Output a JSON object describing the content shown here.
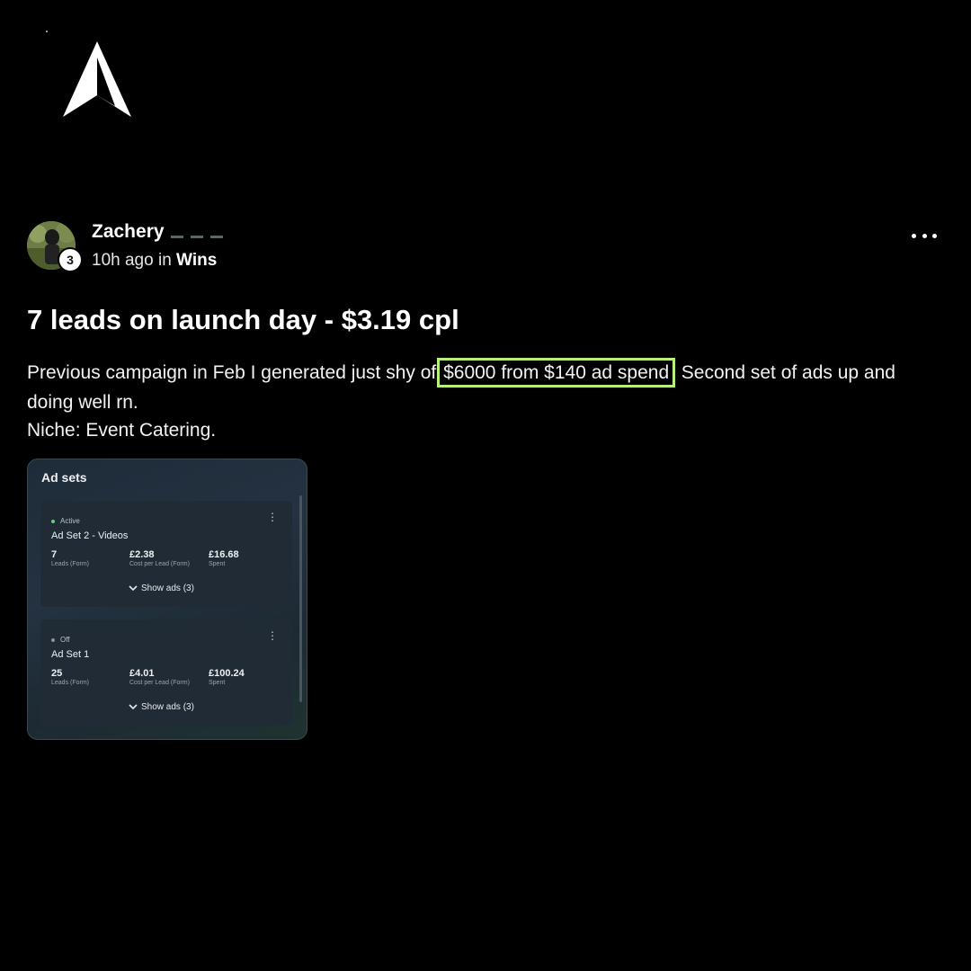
{
  "post": {
    "author": "Zachery",
    "avatar_level": "3",
    "time_ago": "10h ago",
    "in_word": "in",
    "category": "Wins",
    "title": "7 leads on launch day - $3.19 cpl",
    "body_before": "Previous campaign in Feb I generated just shy of ",
    "body_highlight": "$6000 from $140 ad spend",
    "body_after": ". Second set of ads up and doing well rn.",
    "niche": "Niche: Event Catering."
  },
  "screenshot": {
    "title": "Ad sets",
    "ad_sets": [
      {
        "status": "Active",
        "status_color": "#5fd37a",
        "name": "Ad Set 2 - Videos",
        "metrics": [
          {
            "value": "7",
            "label": "Leads (Form)"
          },
          {
            "value": "£2.38",
            "label": "Cost per Lead (Form)"
          },
          {
            "value": "£16.68",
            "label": "Spent"
          }
        ],
        "show_ads": "Show ads (3)"
      },
      {
        "status": "Off",
        "status_color": "#8a949c",
        "name": "Ad Set 1",
        "metrics": [
          {
            "value": "25",
            "label": "Leads (Form)"
          },
          {
            "value": "£4.01",
            "label": "Cost per Lead (Form)"
          },
          {
            "value": "£100.24",
            "label": "Spent"
          }
        ],
        "show_ads": "Show ads (3)"
      }
    ]
  },
  "icons": {
    "logo": "arrow-logo-icon",
    "more": "more-horizontal-icon",
    "chevron": "chevron-down-icon",
    "kebab": "more-vertical-icon"
  },
  "colors": {
    "background": "#000000",
    "highlight": "#b8f07a"
  }
}
